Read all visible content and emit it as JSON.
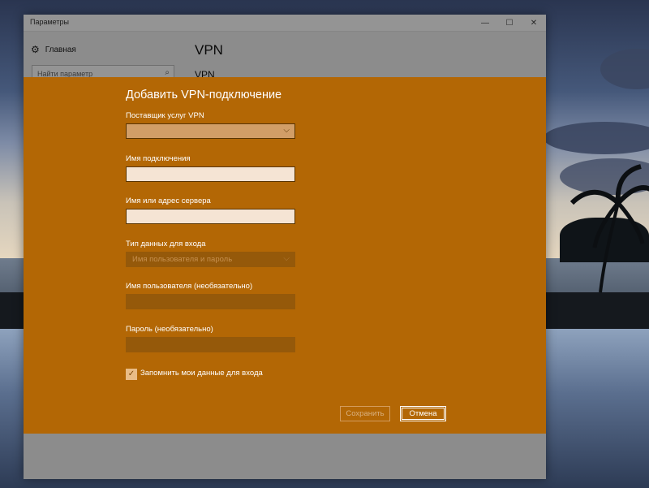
{
  "window": {
    "title": "Параметры",
    "minimize_glyph": "—",
    "maximize_glyph": "☐",
    "close_glyph": "✕"
  },
  "nav": {
    "home_label": "Главная",
    "home_icon": "gear-icon",
    "search_placeholder": "Найти параметр",
    "search_icon": "search-icon"
  },
  "page": {
    "heading": "VPN",
    "subheading": "VPN"
  },
  "dialog": {
    "title": "Добавить VPN-подключение",
    "provider": {
      "label": "Поставщик услуг VPN",
      "value": ""
    },
    "connection_name": {
      "label": "Имя подключения",
      "value": ""
    },
    "server": {
      "label": "Имя или адрес сервера",
      "value": ""
    },
    "signin_type": {
      "label": "Тип данных для входа",
      "value": "Имя пользователя и пароль"
    },
    "username": {
      "label": "Имя пользователя (необязательно)",
      "value": ""
    },
    "password": {
      "label": "Пароль (необязательно)",
      "value": ""
    },
    "remember": {
      "label": "Запомнить мои данные для входа",
      "checked": true
    },
    "save_button": "Сохранить",
    "cancel_button": "Отмена",
    "accent_color": "#b36705"
  }
}
